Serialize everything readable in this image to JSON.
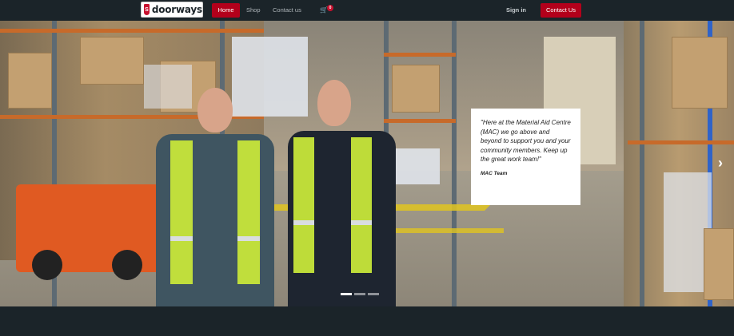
{
  "brand": {
    "name": "doorways",
    "mark": "S",
    "color": "#c8102e"
  },
  "nav": {
    "home": "Home",
    "shop": "Shop",
    "contact": "Contact us",
    "cart_icon": "shopping-cart-icon",
    "cart_count": "0",
    "signin": "Sign in",
    "contact_button": "Contact Us",
    "accent": "#b3001b"
  },
  "hero": {
    "quote": "\"Here at the Material Aid Centre (MAC) we go above and beyond to support you and your community members. Keep up the great work team!\"",
    "author": "MAC Team",
    "next_icon": "chevron-right-icon",
    "slides": 3,
    "active_slide": 1
  }
}
